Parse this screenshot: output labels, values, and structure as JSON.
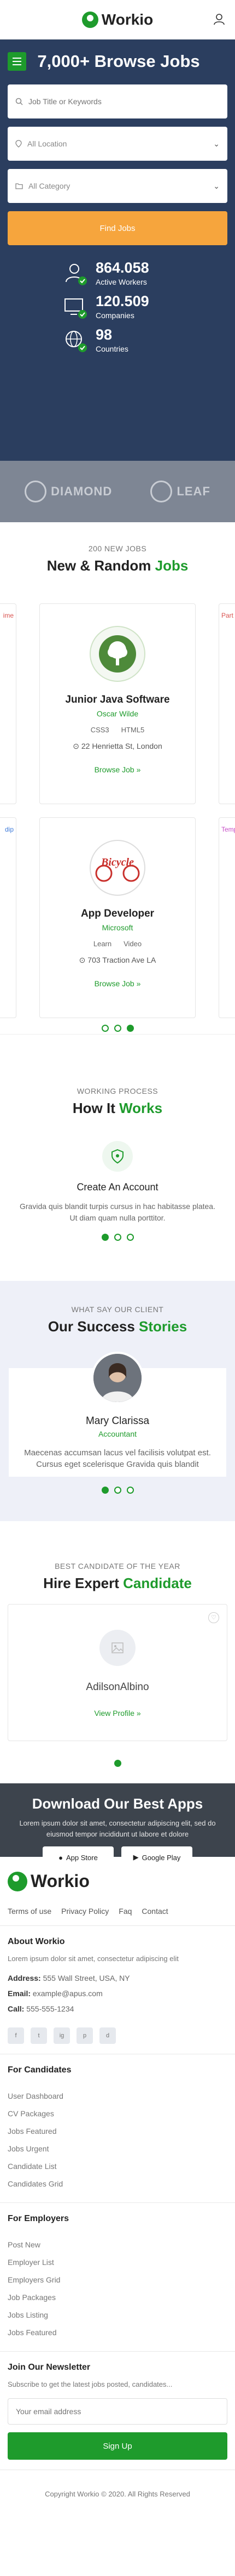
{
  "brand": {
    "name": "Workio",
    "accent": "#1e9b2c",
    "orange": "#f6a53d",
    "navy": "#2b3e5f"
  },
  "hero": {
    "title": "7,000+ Browse Jobs",
    "search_placeholder": "Job Title or Keywords",
    "location": "All Location",
    "category": "All Category",
    "find_label": "Find Jobs",
    "stats": [
      {
        "value": "864.058",
        "label": "Active Workers",
        "icon": "user-icon"
      },
      {
        "value": "120.509",
        "label": "Companies",
        "icon": "monitor-icon"
      },
      {
        "value": "98",
        "label": "Countries",
        "icon": "globe-icon"
      }
    ]
  },
  "brands": [
    "DIAMOND",
    "LEAF"
  ],
  "jobs": {
    "kicker": "200 NEW JOBS",
    "title_main": "New & Random ",
    "title_accent": "Jobs",
    "peek_tags": [
      "ime",
      "Part T",
      "dip",
      "Tempo"
    ],
    "items": [
      {
        "title": "Junior Java Software",
        "company": "Oscar Wilde",
        "skills": [
          "CSS3",
          "HTML5"
        ],
        "location": "22 Henrietta St, London",
        "type": "Part T",
        "link": "Browse Job »"
      },
      {
        "title": "App Developer",
        "company": "Microsoft",
        "skills": [
          "Learn",
          "Video"
        ],
        "location": "703 Traction Ave LA",
        "type": "Tempo",
        "link": "Browse Job »"
      }
    ]
  },
  "how": {
    "kicker": "WORKING PROCESS",
    "title_main": "How It ",
    "title_accent": "Works",
    "step": "Create An Account",
    "desc": "Gravida quis blandit turpis cursus in hac habitasse platea. Ut diam quam nulla porttitor."
  },
  "success": {
    "kicker": "WHAT SAY OUR CLIENT",
    "title_main": "Our Success ",
    "title_accent": "Stories",
    "name": "Mary Clarissa",
    "role": "Accountant",
    "text": "Maecenas accumsan lacus vel facilisis volutpat est. Cursus eget scelerisque Gravida quis blandit"
  },
  "hire": {
    "kicker": "BEST CANDIDATE OF THE YEAR",
    "title_main": "Hire Expert ",
    "title_accent": "Candidate",
    "name": "AdilsonAlbino",
    "link": "View Profile »"
  },
  "apps": {
    "title": "Download Our Best Apps",
    "desc": "Lorem ipsum dolor sit amet, consectetur adipiscing elit, sed do eiusmod tempor incididunt ut labore et dolore",
    "app_store": "App Store",
    "google_play": "Google Play"
  },
  "footer": {
    "links": [
      "Terms of use",
      "Privacy Policy",
      "Faq",
      "Contact"
    ],
    "about_title": "About Workio",
    "about_text": "Lorem ipsum dolor sit amet, consectetur adipiscing elit",
    "address_label": "Address:",
    "address": "555 Wall Street, USA, NY",
    "email_label": "Email:",
    "email": "example@apus.com",
    "call_label": "Call:",
    "phone": "555-555-1234",
    "socials": [
      "f",
      "t",
      "ig",
      "p",
      "d"
    ],
    "candidates_title": "For Candidates",
    "candidates": [
      "User Dashboard",
      "CV Packages",
      "Jobs Featured",
      "Jobs Urgent",
      "Candidate List",
      "Candidates Grid"
    ],
    "employers_title": "For Employers",
    "employers": [
      "Post New",
      "Employer List",
      "Employers Grid",
      "Job Packages",
      "Jobs Listing",
      "Jobs Featured"
    ],
    "newsletter_title": "Join Our Newsletter",
    "newsletter_text": "Subscribe to get the latest jobs posted, candidates...",
    "email_placeholder": "Your email address",
    "signup_label": "Sign Up",
    "copyright": "Copyright Workio © 2020. All Rights Reserved"
  }
}
